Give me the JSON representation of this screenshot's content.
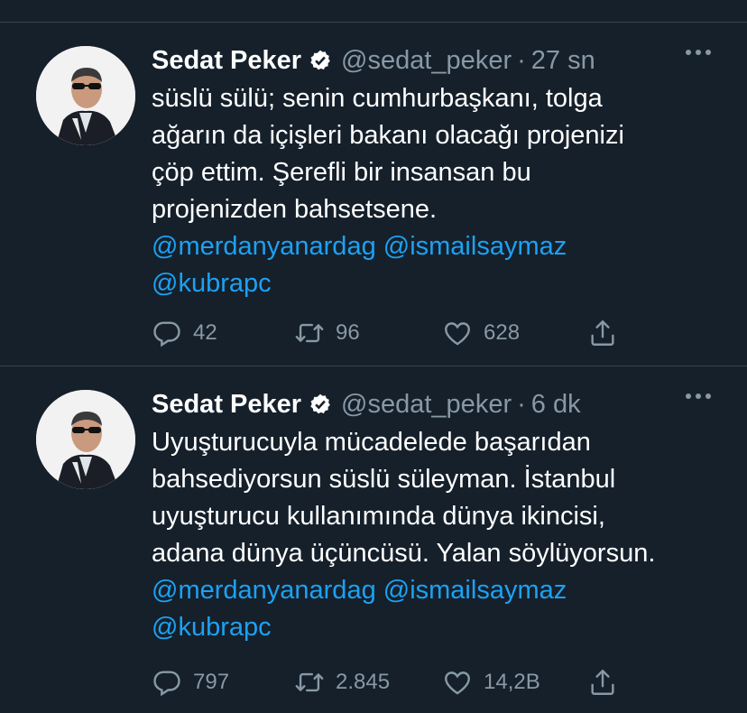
{
  "tweets": [
    {
      "name": "Sedat Peker",
      "handle": "@sedat_peker",
      "separator": "·",
      "time": "27 sn",
      "lines": [
        "süslü sülü; senin cumhurbaşkanı, tolga",
        "ağarın da içişleri bakanı olacağı projenizi",
        "çöp ettim. Şerefli bir insansan bu",
        "projenizden bahsetsene."
      ],
      "mentions_line1": [
        "@merdanyanardag",
        "@ismailsaymaz"
      ],
      "mentions_line2": [
        "@kubrapc"
      ],
      "replies": "42",
      "retweets": "96",
      "likes": "628"
    },
    {
      "name": "Sedat Peker",
      "handle": "@sedat_peker",
      "separator": "·",
      "time": "6 dk",
      "lines": [
        "Uyuşturucuyla mücadelede başarıdan",
        "bahsediyorsun süslü süleyman. İstanbul",
        "uyuşturucu kullanımında dünya ikincisi,",
        "adana dünya üçüncüsü. Yalan söylüyorsun."
      ],
      "mentions_line1": [
        "@merdanyanardag",
        "@ismailsaymaz"
      ],
      "mentions_line2": [
        "@kubrapc"
      ],
      "replies": "797",
      "retweets": "2.845",
      "likes": "14,2B"
    }
  ],
  "icons": {
    "verified": "verified-badge-icon",
    "more": "more-options-icon",
    "reply": "reply-icon",
    "retweet": "retweet-icon",
    "like": "heart-icon",
    "share": "share-icon"
  },
  "colors": {
    "background": "#15202b",
    "divider": "#38444d",
    "text": "#ffffff",
    "secondary": "#8899a6",
    "link": "#1da1f2"
  }
}
